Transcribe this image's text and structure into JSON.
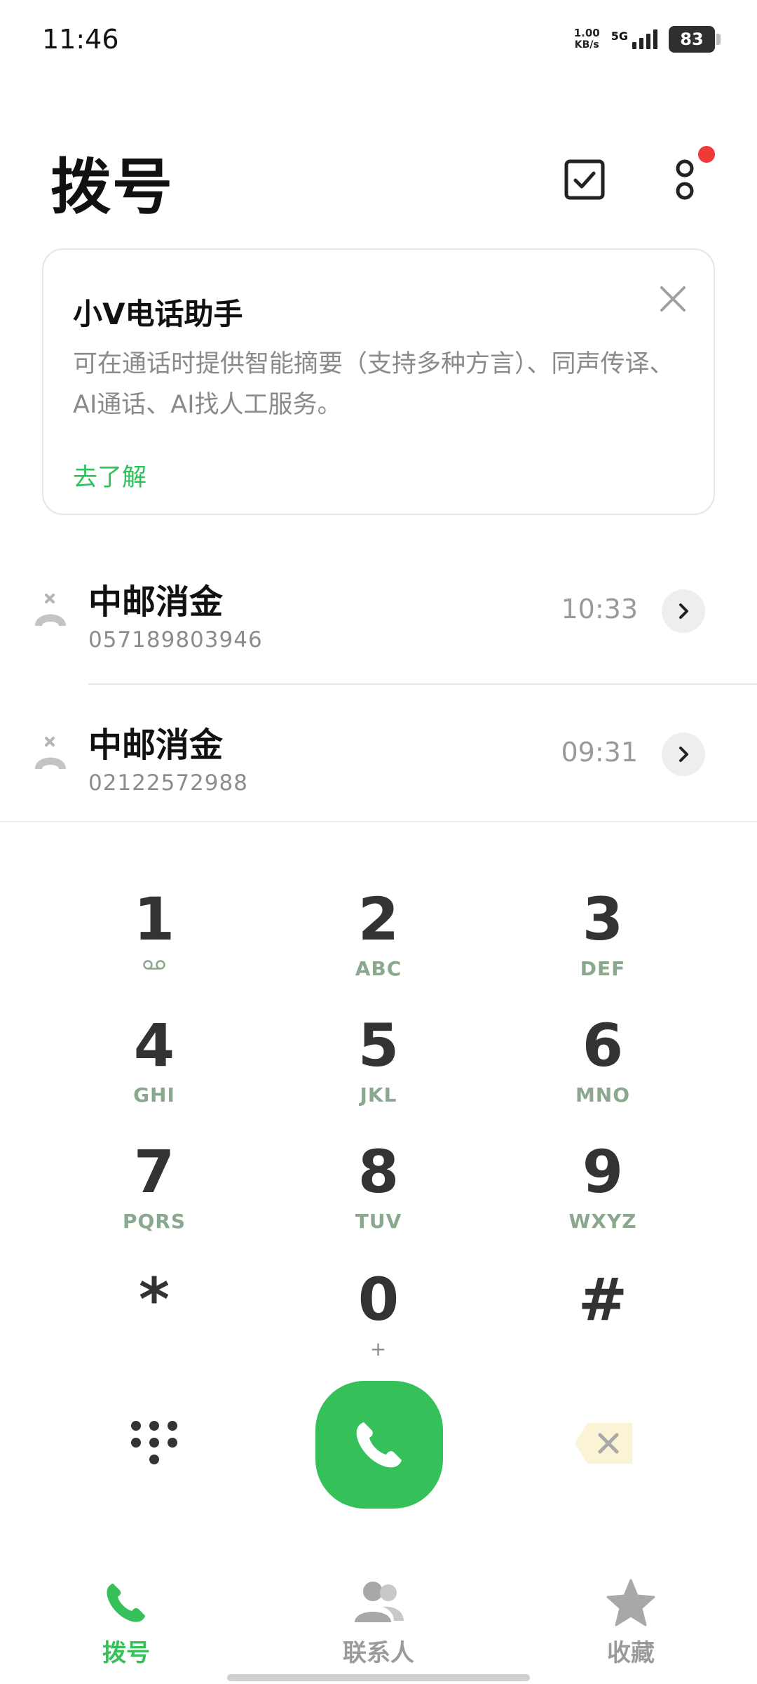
{
  "status_bar": {
    "time": "11:46",
    "net_speed_value": "1.00",
    "net_speed_unit": "KB/s",
    "network_type": "5G",
    "battery": "83"
  },
  "header": {
    "title": "拨号",
    "select_icon": "checkbox-icon",
    "more_icon": "more-vertical-icon"
  },
  "assistant_card": {
    "title": "小V电话助手",
    "description": "可在通话时提供智能摘要（支持多种方言）、同声传译、AI通话、AI找人工服务。",
    "link": "去了解"
  },
  "calls": [
    {
      "name": "中邮消金",
      "number": "057189803946",
      "time": "10:33"
    },
    {
      "name": "中邮消金",
      "number": "02122572988",
      "time": "09:31"
    }
  ],
  "keypad": {
    "keys": [
      {
        "digit": "1",
        "letters": ""
      },
      {
        "digit": "2",
        "letters": "ABC"
      },
      {
        "digit": "3",
        "letters": "DEF"
      },
      {
        "digit": "4",
        "letters": "GHI"
      },
      {
        "digit": "5",
        "letters": "JKL"
      },
      {
        "digit": "6",
        "letters": "MNO"
      },
      {
        "digit": "7",
        "letters": "PQRS"
      },
      {
        "digit": "8",
        "letters": "TUV"
      },
      {
        "digit": "9",
        "letters": "WXYZ"
      },
      {
        "digit": "*",
        "letters": ""
      },
      {
        "digit": "0",
        "letters": "+"
      },
      {
        "digit": "#",
        "letters": ""
      }
    ]
  },
  "tabs": [
    {
      "label": "拨号",
      "active": true
    },
    {
      "label": "联系人",
      "active": false
    },
    {
      "label": "收藏",
      "active": false
    }
  ],
  "colors": {
    "accent_green": "#36c05a",
    "link_green": "#2ec25a",
    "badge_red": "#f03a3a",
    "key_letters": "#8aa88e",
    "inactive_tab": "#9b9b9b"
  }
}
